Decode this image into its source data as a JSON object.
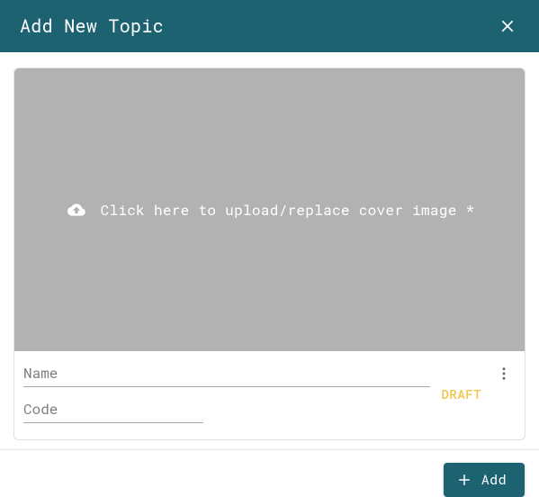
{
  "header": {
    "title": "Add New Topic"
  },
  "cover": {
    "prompt": "Click here to upload/replace cover image *"
  },
  "fields": {
    "name": {
      "placeholder": "Name",
      "value": ""
    },
    "code": {
      "placeholder": "Code",
      "value": ""
    }
  },
  "status": {
    "label": "DRAFT"
  },
  "footer": {
    "add_label": "Add"
  },
  "colors": {
    "brand": "#1d6270",
    "status": "#f2c548",
    "cover_bg": "#b2b2b2"
  }
}
